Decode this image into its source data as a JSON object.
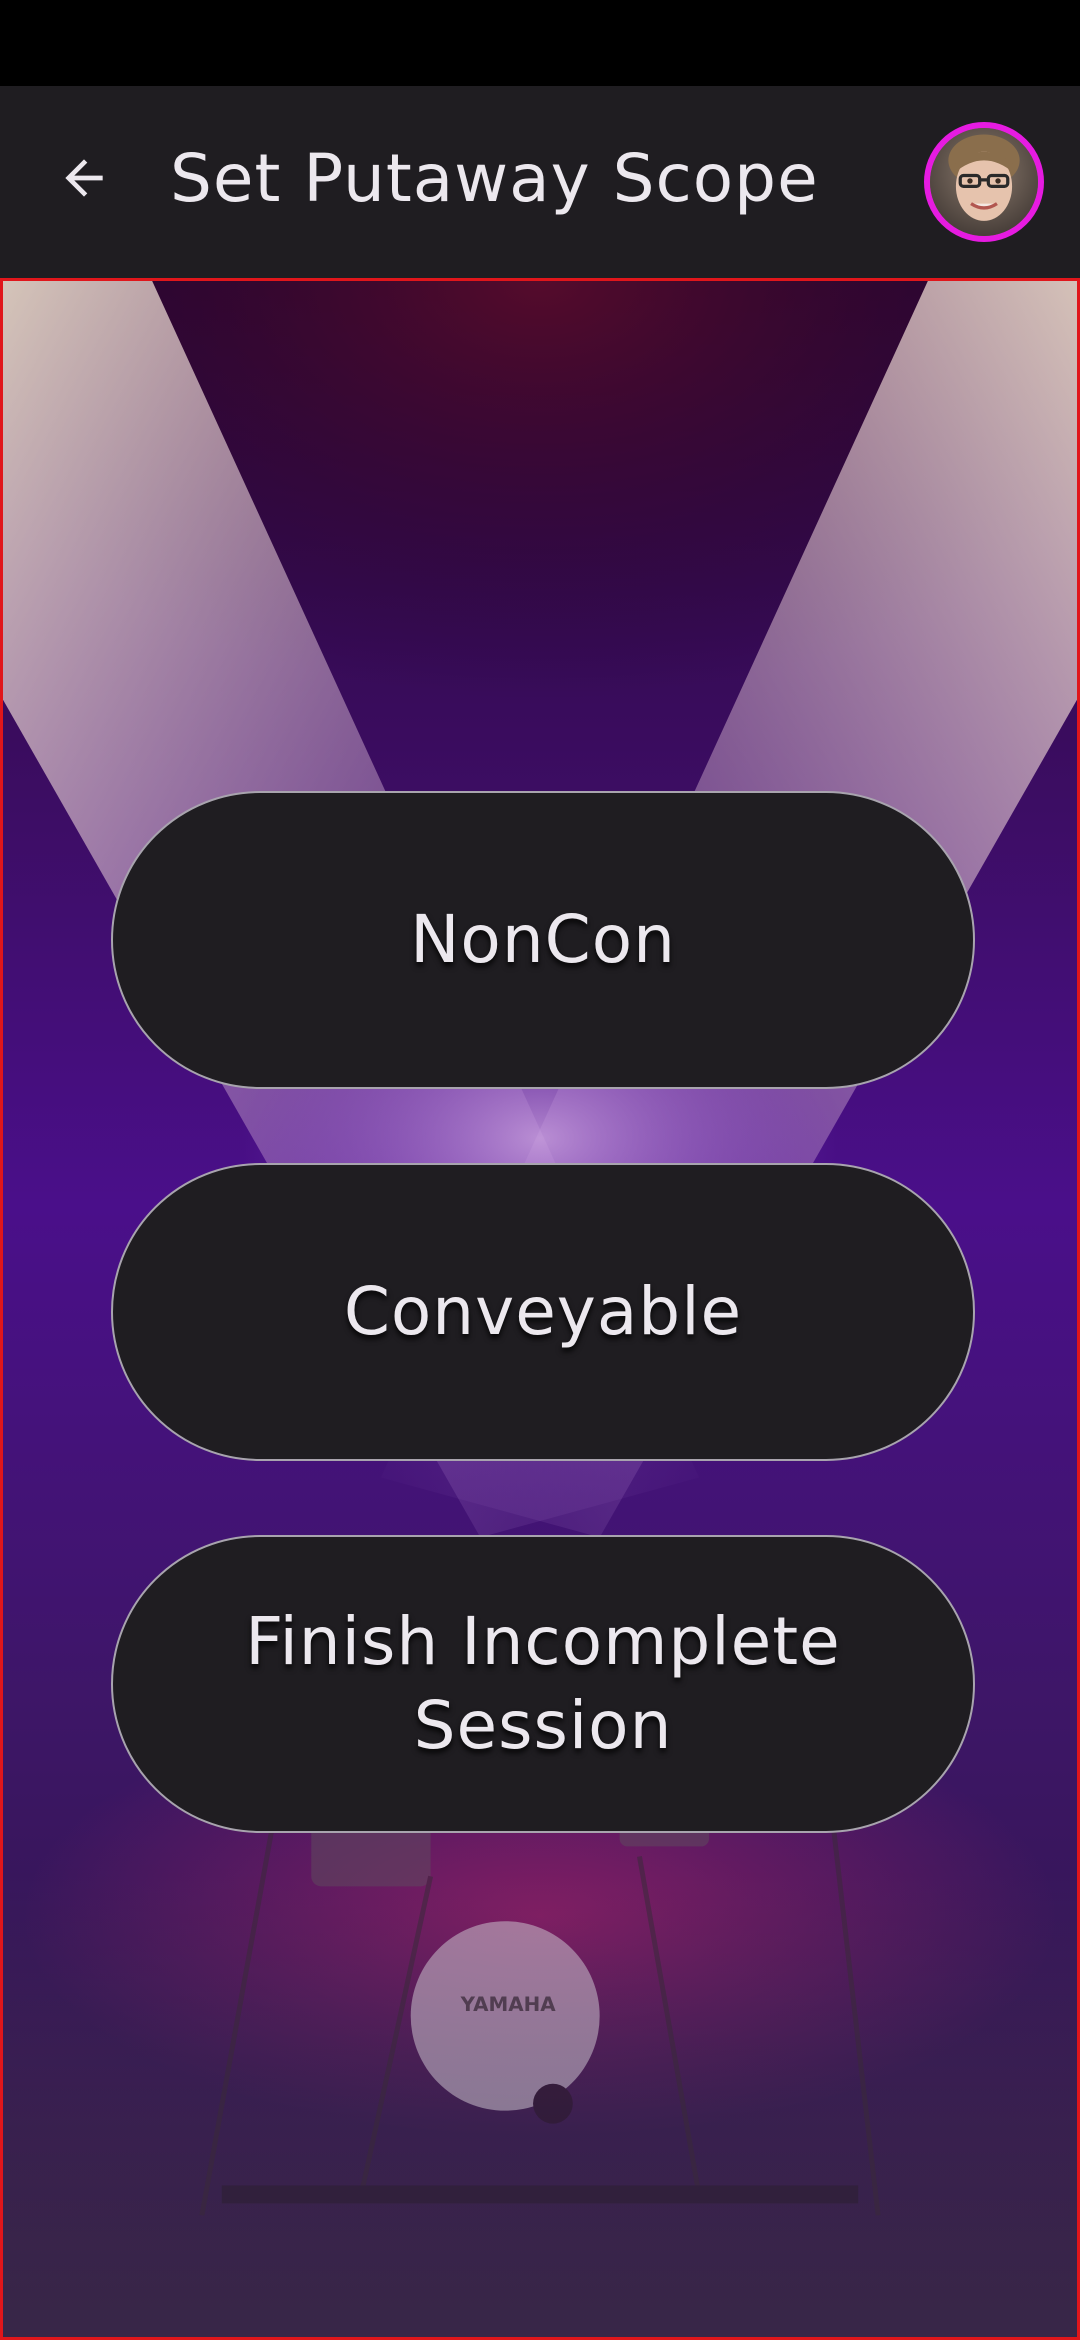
{
  "app_bar": {
    "back_icon": "arrow-left-icon",
    "title": "Set Putaway Scope",
    "avatar_icon": "user-avatar",
    "avatar_ring_color": "#e61be1"
  },
  "scope_options": [
    {
      "label": "NonCon"
    },
    {
      "label": "Conveyable"
    },
    {
      "label": "Finish Incomplete Session"
    }
  ],
  "background": {
    "description_icon": "concert-stage-background",
    "drum_brand": "YAMAHA"
  },
  "colors": {
    "app_bar": "#1f1d21",
    "button_fill": "#1f1d21",
    "button_border": "#a8a4ae",
    "content_border": "#e0161b",
    "text": "#ece8ee"
  }
}
